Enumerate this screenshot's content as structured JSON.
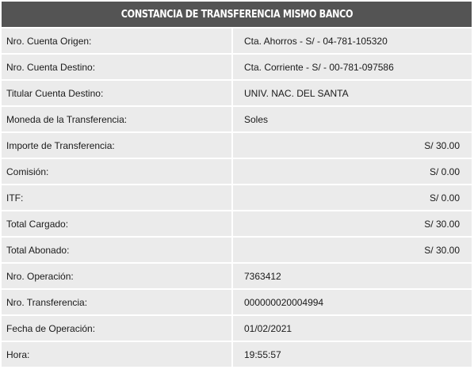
{
  "header": {
    "title": "CONSTANCIA DE TRANSFERENCIA MISMO BANCO"
  },
  "rows": [
    {
      "label": "Nro. Cuenta Origen:",
      "value": "Cta. Ahorros - S/ - 04-781-105320",
      "align": "left"
    },
    {
      "label": "Nro. Cuenta Destino:",
      "value": "Cta. Corriente - S/ - 00-781-097586",
      "align": "left"
    },
    {
      "label": "Titular Cuenta Destino:",
      "value": "UNIV. NAC. DEL SANTA",
      "align": "left"
    },
    {
      "label": "Moneda de la Transferencia:",
      "value": "Soles",
      "align": "left"
    },
    {
      "label": "Importe de Transferencia:",
      "value": "S/ 30.00",
      "align": "right"
    },
    {
      "label": "Comisión:",
      "value": "S/ 0.00",
      "align": "right"
    },
    {
      "label": "ITF:",
      "value": "S/ 0.00",
      "align": "right"
    },
    {
      "label": "Total Cargado:",
      "value": "S/ 30.00",
      "align": "right"
    },
    {
      "label": "Total Abonado:",
      "value": "S/ 30.00",
      "align": "right"
    },
    {
      "label": "Nro. Operación:",
      "value": "7363412",
      "align": "left"
    },
    {
      "label": "Nro. Transferencia:",
      "value": "000000020004994",
      "align": "left"
    },
    {
      "label": "Fecha de Operación:",
      "value": "01/02/2021",
      "align": "left"
    },
    {
      "label": "Hora:",
      "value": "19:55:57",
      "align": "left"
    }
  ]
}
